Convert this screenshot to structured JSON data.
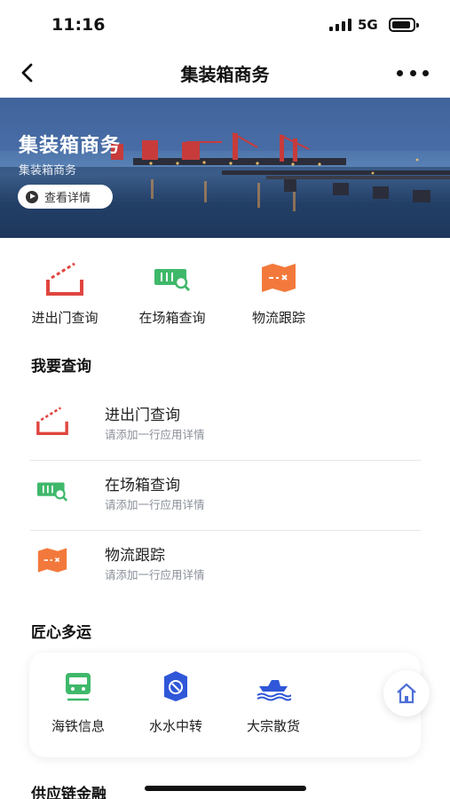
{
  "status_bar": {
    "time": "11:16",
    "network": "5G"
  },
  "nav": {
    "title": "集装箱商务"
  },
  "banner": {
    "title": "集装箱商务",
    "subtitle": "集装箱商务",
    "button_label": "查看详情"
  },
  "quick_actions": [
    {
      "label": "进出门查询",
      "icon": "gate-barrier-icon"
    },
    {
      "label": "在场箱查询",
      "icon": "container-search-icon"
    },
    {
      "label": "物流跟踪",
      "icon": "map-tracking-icon"
    }
  ],
  "query_section": {
    "title": "我要查询",
    "items": [
      {
        "title": "进出门查询",
        "desc": "请添加一行应用详情",
        "icon": "gate-barrier-icon"
      },
      {
        "title": "在场箱查询",
        "desc": "请添加一行应用详情",
        "icon": "container-search-icon"
      },
      {
        "title": "物流跟踪",
        "desc": "请添加一行应用详情",
        "icon": "map-tracking-icon"
      }
    ]
  },
  "multimodal_section": {
    "title": "匠心多运",
    "items": [
      {
        "label": "海铁信息",
        "icon": "train-icon"
      },
      {
        "label": "水水中转",
        "icon": "transfer-badge-icon"
      },
      {
        "label": "大宗散货",
        "icon": "ship-icon"
      }
    ]
  },
  "finance_section": {
    "title": "供应链金融"
  },
  "colors": {
    "red": "#e0453f",
    "green": "#3fb86a",
    "orange": "#f2793b",
    "blue": "#2f57d8",
    "fab_icon": "#4f6fd8"
  }
}
